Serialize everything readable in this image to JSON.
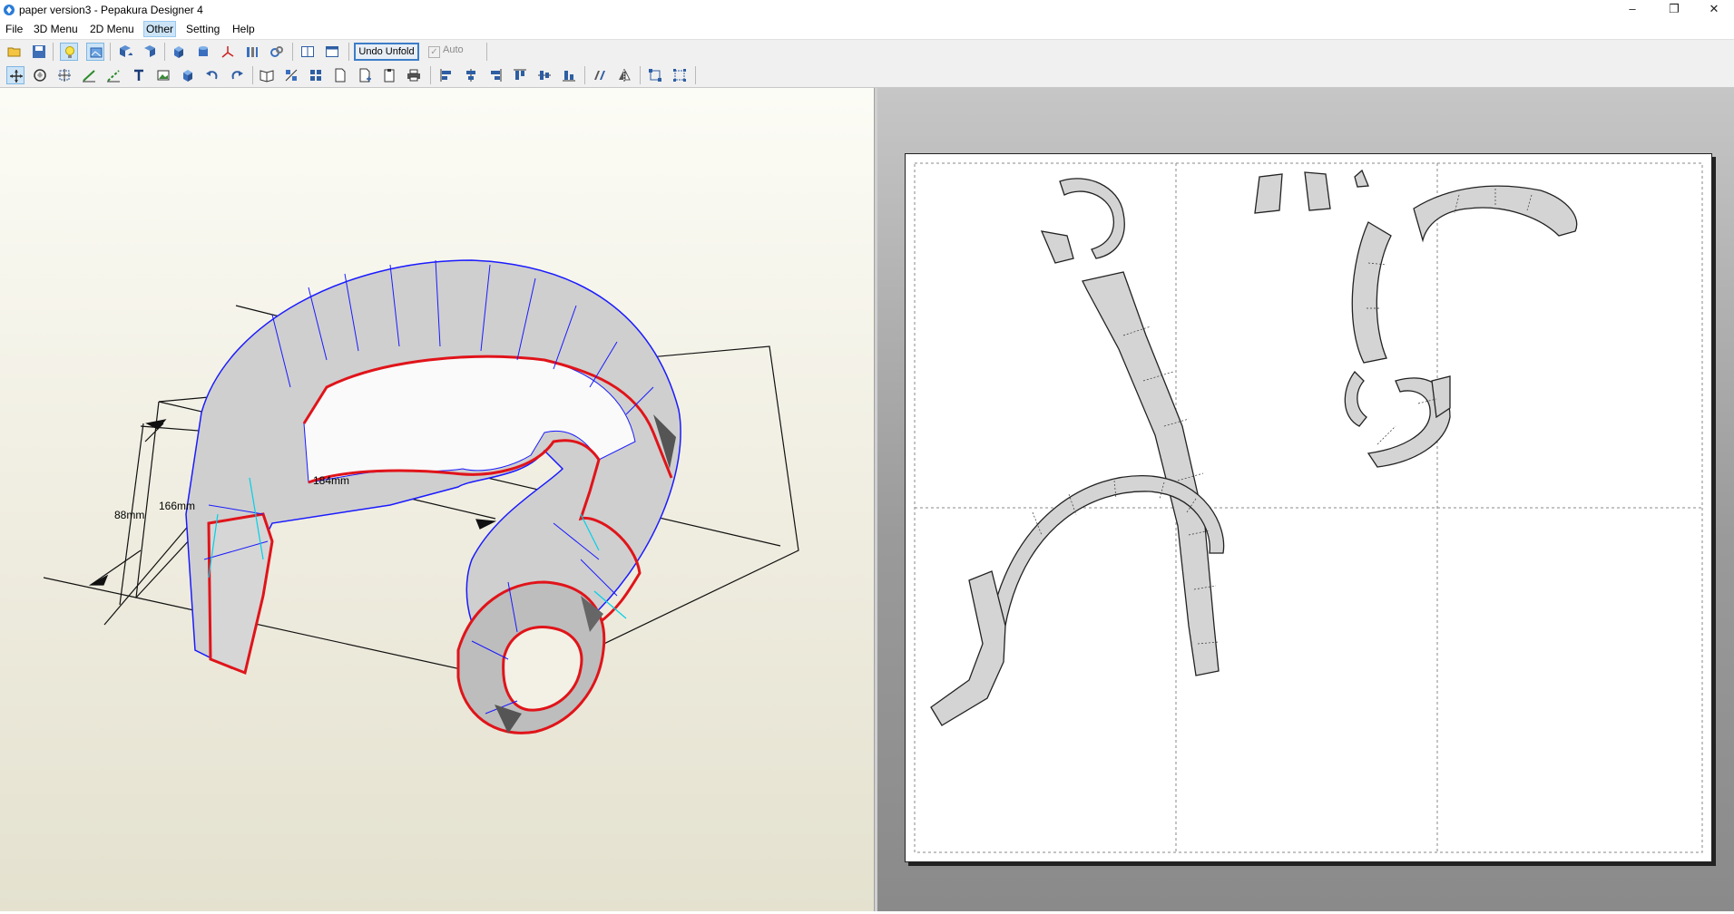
{
  "window": {
    "title": "paper version3 - Pepakura Designer 4",
    "minimize_glyph": "–",
    "restore_glyph": "❐",
    "close_glyph": "✕"
  },
  "menu": {
    "items": [
      "File",
      "3D Menu",
      "2D Menu",
      "Other",
      "Setting",
      "Help"
    ],
    "active_index": 3
  },
  "toolbar": {
    "undo_unfold_label": "Undo Unfold",
    "auto_label": "Auto",
    "auto_checked": true
  },
  "view3d": {
    "dimensions": {
      "width_label": "184mm",
      "depth_label": "166mm",
      "height_label": "88mm"
    }
  },
  "colors": {
    "cut_line": "#e0141a",
    "mesh_edge": "#1a1aff",
    "fold_edge": "#00d0e8",
    "face_fill": "#c8c8c8",
    "dark_face": "#555555",
    "pressed_button": "#cce4f7"
  },
  "icons": {
    "toolbar1": [
      "open-icon",
      "save-icon",
      "lightbulb-icon",
      "texture-icon",
      "unfold-icon",
      "rotate-icon",
      "cube-icon",
      "cylinder-icon",
      "axis-icon",
      "bars-icon",
      "edge-link-icon",
      "layout-single-icon",
      "layout-split-icon"
    ],
    "toolbar2": [
      "select-icon",
      "rotate-part-icon",
      "fit-icon",
      "line-icon",
      "fold-line-icon",
      "text-icon",
      "image-icon",
      "box-icon",
      "undo-icon",
      "redo-icon",
      "open-book-icon",
      "arrange-icon",
      "grid-icon",
      "page-icon",
      "page-add-icon",
      "clipboard-icon",
      "printer-icon",
      "align-left-icon",
      "align-center-icon",
      "align-right-icon",
      "align-top-icon",
      "align-middle-icon",
      "align-bottom-icon",
      "distribute-icon",
      "flip-icon",
      "bounding-icon",
      "grid-select-icon"
    ]
  }
}
